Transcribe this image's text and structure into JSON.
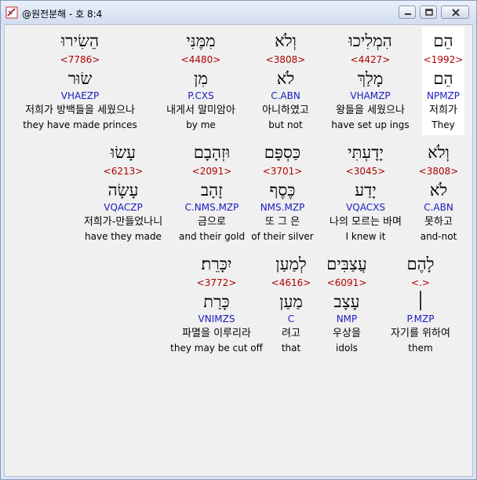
{
  "window": {
    "title": "@원전분해 - 호 8:4"
  },
  "rows": [
    {
      "words": [
        {
          "hebrew": "הֵם",
          "strong": "<1992>",
          "lemma": "הֵם",
          "parse": "NPMZP",
          "korean": "저희가",
          "english": "They",
          "selected": true
        },
        {
          "hebrew": "הִמְלִיכוּ",
          "strong": "<4427>",
          "lemma": "מָלַךְ",
          "parse": "VHAMZP",
          "korean": "왕들을 세웠으나",
          "english": "have set up ings"
        },
        {
          "hebrew": "וְלֹא",
          "strong": "<3808>",
          "lemma": "לֹא",
          "parse": "C.ABN",
          "korean": "아니하였고",
          "english": "but not"
        },
        {
          "hebrew": "מִמֶּנִּי",
          "strong": "<4480>",
          "lemma": "מִן",
          "parse": "P.CXS",
          "korean": "내게서 말미암아",
          "english": "by me"
        },
        {
          "hebrew": "הֵשִׂירוּ",
          "strong": "<7786>",
          "lemma": "שׂוּר",
          "parse": "VHAEZP",
          "korean": "저희가 방백들을 세웠으나",
          "english": "they have made princes"
        }
      ]
    },
    {
      "words": [
        {
          "hebrew": "וְלֹא",
          "strong": "<3808>",
          "lemma": "לֹא",
          "parse": "C.ABN",
          "korean": "못하고",
          "english": "and-not"
        },
        {
          "hebrew": "יָדָעְתִּי",
          "strong": "<3045>",
          "lemma": "יָדַע",
          "parse": "VQACXS",
          "korean": "나의 모르는 바며",
          "english": "I knew it"
        },
        {
          "hebrew": "כַּסְפָּם",
          "strong": "<3701>",
          "lemma": "כֶּסֶף",
          "parse": "NMS.MZP",
          "korean": "또 그 은",
          "english": "of their silver"
        },
        {
          "hebrew": "וּזְהָבָם",
          "strong": "<2091>",
          "lemma": "זָהָב",
          "parse": "C.NMS.MZP",
          "korean": "금으로",
          "english": "and their gold"
        },
        {
          "hebrew": "עָשׂוּ",
          "strong": "<6213>",
          "lemma": "עָשָׂה",
          "parse": "VQACZP",
          "korean": "저희가-만들었나니",
          "english": "have they made"
        }
      ]
    },
    {
      "words": [
        {
          "hebrew": "לָהֶם",
          "strong": "<.>",
          "lemma": "׀",
          "parse": "P.MZP",
          "korean": "자기를 위하여",
          "english": "them"
        },
        {
          "hebrew": "עֲצַבִּים",
          "strong": "<6091>",
          "lemma": "עָצָב",
          "parse": "NMP",
          "korean": "우상을",
          "english": "idols"
        },
        {
          "hebrew": "לְמַעַן",
          "strong": "<4616>",
          "lemma": "מַעַן",
          "parse": "C",
          "korean": "려고",
          "english": "that"
        },
        {
          "hebrew": "יִכָּרֵת׃",
          "strong": "<3772>",
          "lemma": "כָּרַת",
          "parse": "VNIMZS",
          "korean": "파멸을 이루리라",
          "english": "they may be cut off"
        }
      ]
    }
  ]
}
